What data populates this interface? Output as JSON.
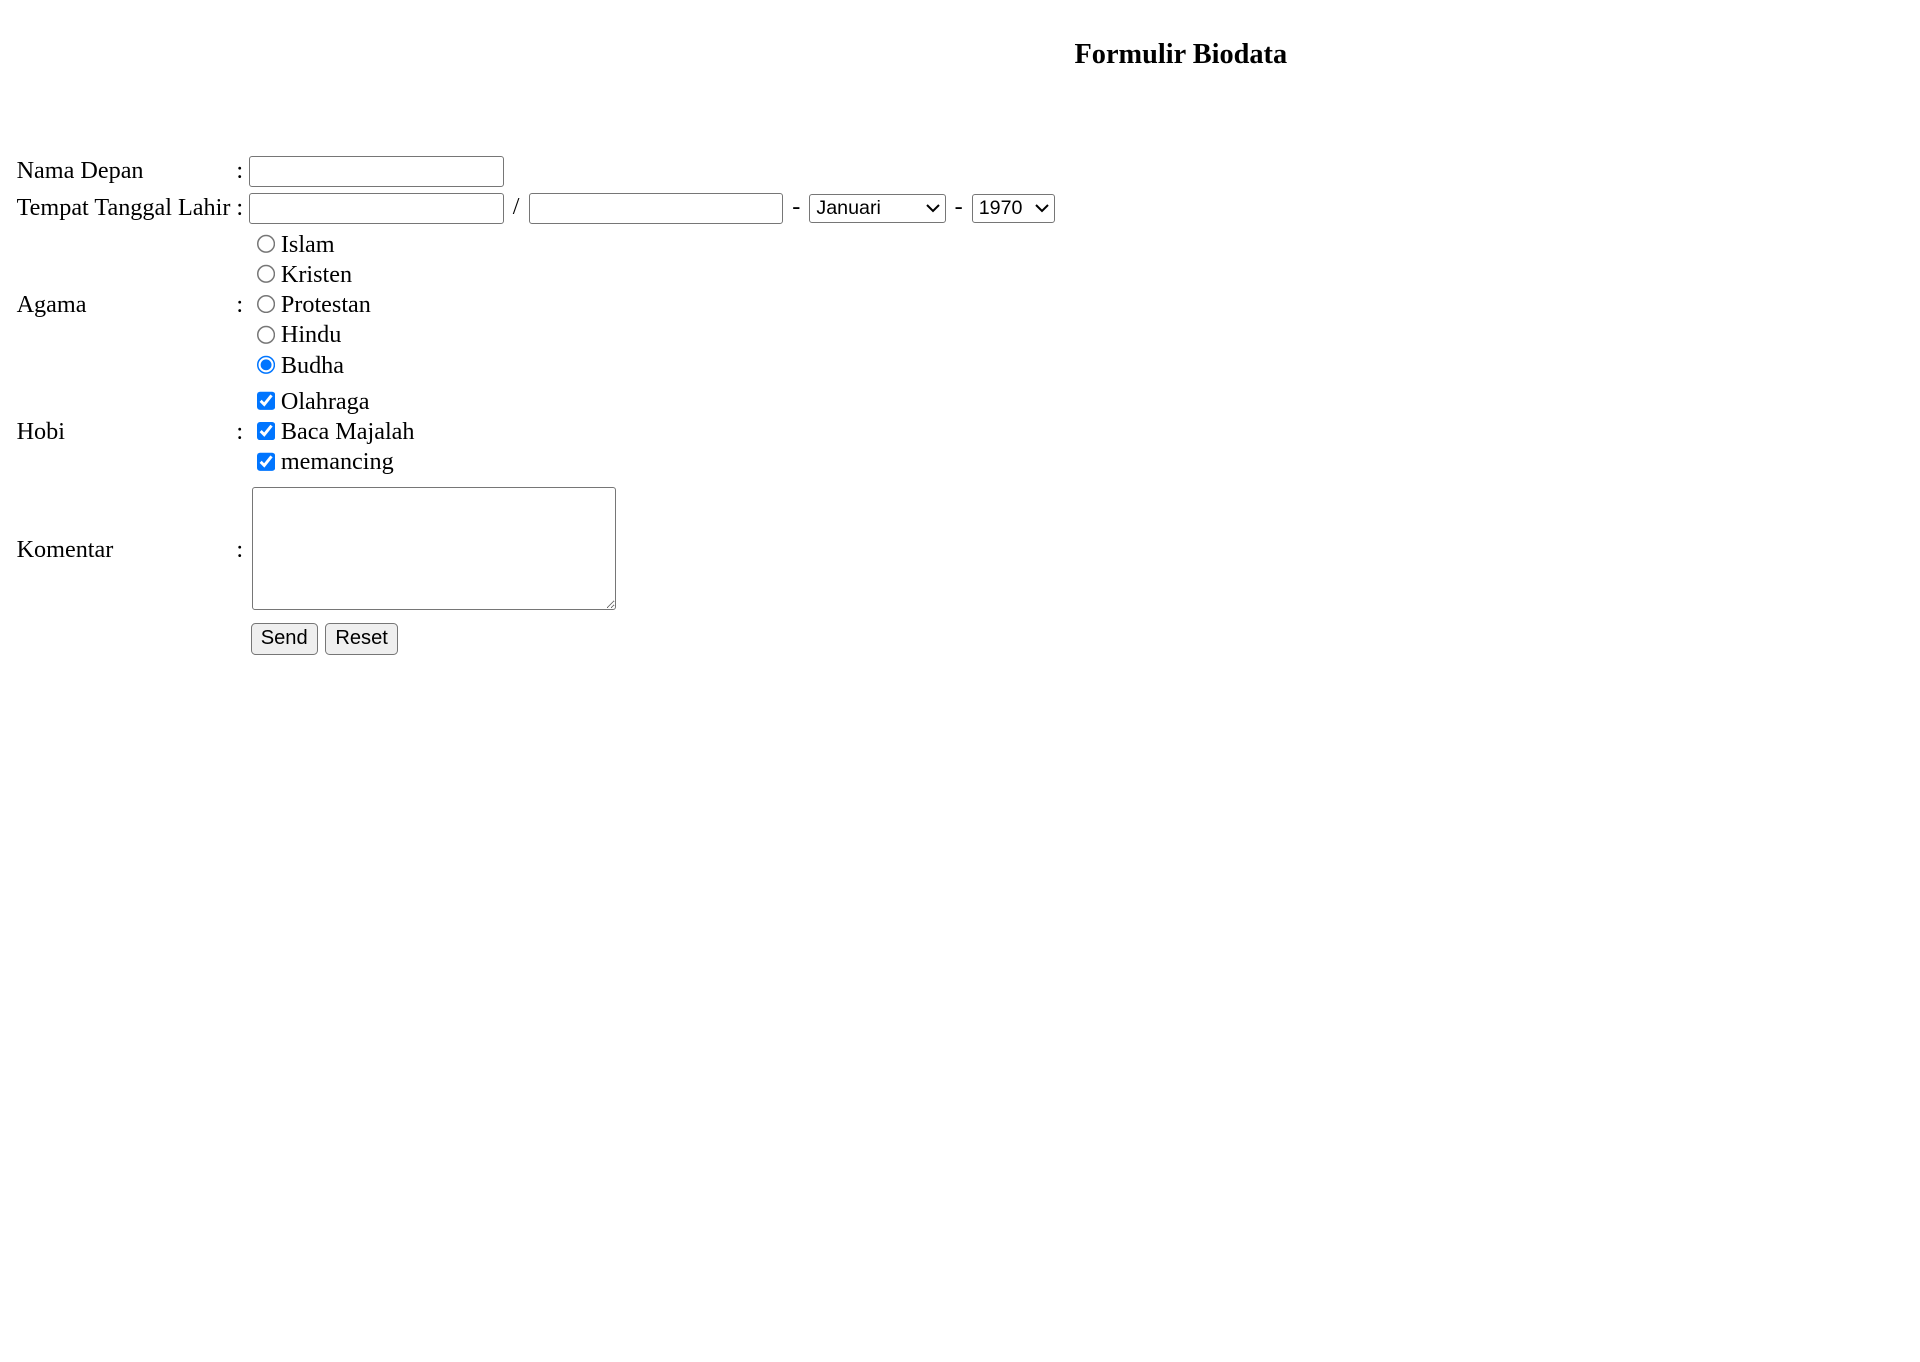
{
  "page": {
    "title": "Formulir Biodata"
  },
  "fields": {
    "nama_depan": {
      "label": "Nama Depan",
      "colon": ":",
      "value": ""
    },
    "ttl": {
      "label": "Tempat Tanggal Lahir",
      "colon": ":",
      "tempat_value": "",
      "tanggal_value": "",
      "slash": "/",
      "dash": "-",
      "bulan_selected": "Januari",
      "tahun_selected": "1970"
    },
    "agama": {
      "label": "Agama",
      "colon": ":",
      "options": [
        {
          "label": "Islam",
          "checked": false
        },
        {
          "label": "Kristen",
          "checked": false
        },
        {
          "label": "Protestan",
          "checked": false
        },
        {
          "label": "Hindu",
          "checked": false
        },
        {
          "label": "Budha",
          "checked": true
        }
      ]
    },
    "hobi": {
      "label": "Hobi",
      "colon": ":",
      "options": [
        {
          "label": "Olahraga",
          "checked": true
        },
        {
          "label": "Baca Majalah",
          "checked": true
        },
        {
          "label": "memancing",
          "checked": true
        }
      ]
    },
    "komentar": {
      "label": "Komentar",
      "colon": ":",
      "value": ""
    }
  },
  "actions": {
    "send_label": "Send",
    "reset_label": "Reset"
  }
}
